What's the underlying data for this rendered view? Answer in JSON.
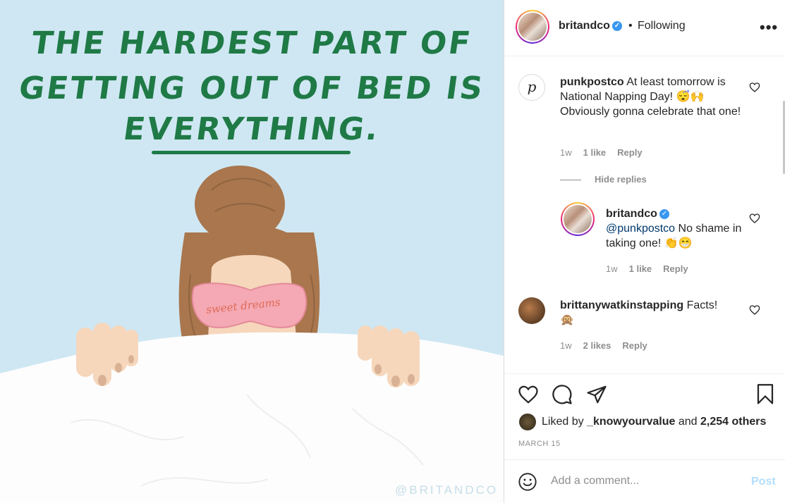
{
  "post_image": {
    "headline_line1": "THE HARDEST PART OF",
    "headline_line2": "GETTING OUT OF BED IS",
    "headline_line3": "EVERYTHING.",
    "mask_text": "sweet dreams",
    "watermark": "@BRITANDCO",
    "colors": {
      "background": "#cfe7f3",
      "headline": "#1f7a46",
      "hair": "#a9764d",
      "mask": "#f4a9b4"
    }
  },
  "header": {
    "username": "britandco",
    "verified_icon": "verified-badge-icon",
    "separator": "•",
    "follow_status": "Following",
    "more_icon": "more-options-icon",
    "more_label": "•••"
  },
  "comments": [
    {
      "username": "punkpostco",
      "avatar_letter": "p",
      "text": "At least tomorrow is National Napping Day! 😴🙌 Obviously gonna celebrate that one!",
      "time": "1w",
      "likes": "1 like",
      "reply_label": "Reply",
      "hide_replies_label": "Hide replies",
      "replies": [
        {
          "username": "britandco",
          "mention": "@punkpostco",
          "text": "No shame in taking one! 👏😁",
          "time": "1w",
          "likes": "1 like",
          "reply_label": "Reply"
        }
      ]
    },
    {
      "username": "brittanywatkinstapping",
      "text": "Facts!",
      "emoji": "🙊",
      "time": "1w",
      "likes": "2 likes",
      "reply_label": "Reply"
    }
  ],
  "actions": {
    "icons": [
      "heart-icon",
      "comment-icon",
      "share-icon",
      "bookmark-icon"
    ],
    "liked_by_prefix": "Liked by",
    "liked_by_user": "_knowyourvalue",
    "liked_by_middle": "and",
    "liked_by_count": "2,254 others",
    "date": "MARCH 15"
  },
  "add_comment": {
    "placeholder": "Add a comment...",
    "post_label": "Post",
    "emoji_icon": "smiley-icon"
  },
  "colors": {
    "accent": "#0095f6",
    "post_disabled": "#b2dffc",
    "verified": "#3897f0",
    "muted": "#8e8e8e"
  }
}
